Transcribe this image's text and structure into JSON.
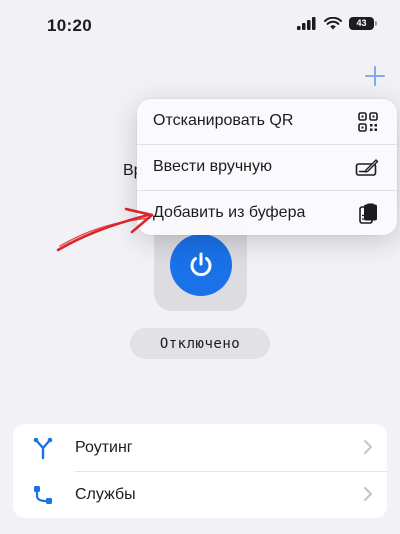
{
  "status_bar": {
    "time": "10:20",
    "battery": "43"
  },
  "header": {
    "add_icon": "plus-icon"
  },
  "main": {
    "partial_label": "Вр",
    "power_icon": "power-icon",
    "connection_status": "Отключено"
  },
  "menu": {
    "items": [
      {
        "label": "Отсканировать QR",
        "icon": "qr-code-icon"
      },
      {
        "label": "Ввести вручную",
        "icon": "signature-icon"
      },
      {
        "label": "Добавить из буфера",
        "icon": "clipboard-icon"
      }
    ]
  },
  "settings": {
    "items": [
      {
        "label": "Роутинг",
        "icon": "routing-icon"
      },
      {
        "label": "Службы",
        "icon": "services-icon"
      }
    ]
  },
  "colors": {
    "accent": "#1a72e8",
    "background": "#f2f2f6",
    "annotation": "#d8262c"
  }
}
